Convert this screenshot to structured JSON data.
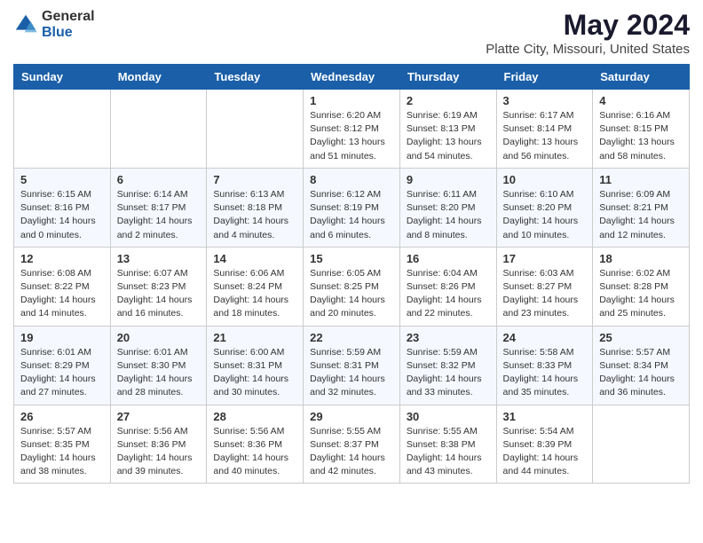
{
  "logo": {
    "general": "General",
    "blue": "Blue"
  },
  "title": "May 2024",
  "subtitle": "Platte City, Missouri, United States",
  "days_of_week": [
    "Sunday",
    "Monday",
    "Tuesday",
    "Wednesday",
    "Thursday",
    "Friday",
    "Saturday"
  ],
  "weeks": [
    [
      {
        "day": "",
        "info": ""
      },
      {
        "day": "",
        "info": ""
      },
      {
        "day": "",
        "info": ""
      },
      {
        "day": "1",
        "info": "Sunrise: 6:20 AM\nSunset: 8:12 PM\nDaylight: 13 hours\nand 51 minutes."
      },
      {
        "day": "2",
        "info": "Sunrise: 6:19 AM\nSunset: 8:13 PM\nDaylight: 13 hours\nand 54 minutes."
      },
      {
        "day": "3",
        "info": "Sunrise: 6:17 AM\nSunset: 8:14 PM\nDaylight: 13 hours\nand 56 minutes."
      },
      {
        "day": "4",
        "info": "Sunrise: 6:16 AM\nSunset: 8:15 PM\nDaylight: 13 hours\nand 58 minutes."
      }
    ],
    [
      {
        "day": "5",
        "info": "Sunrise: 6:15 AM\nSunset: 8:16 PM\nDaylight: 14 hours\nand 0 minutes."
      },
      {
        "day": "6",
        "info": "Sunrise: 6:14 AM\nSunset: 8:17 PM\nDaylight: 14 hours\nand 2 minutes."
      },
      {
        "day": "7",
        "info": "Sunrise: 6:13 AM\nSunset: 8:18 PM\nDaylight: 14 hours\nand 4 minutes."
      },
      {
        "day": "8",
        "info": "Sunrise: 6:12 AM\nSunset: 8:19 PM\nDaylight: 14 hours\nand 6 minutes."
      },
      {
        "day": "9",
        "info": "Sunrise: 6:11 AM\nSunset: 8:20 PM\nDaylight: 14 hours\nand 8 minutes."
      },
      {
        "day": "10",
        "info": "Sunrise: 6:10 AM\nSunset: 8:20 PM\nDaylight: 14 hours\nand 10 minutes."
      },
      {
        "day": "11",
        "info": "Sunrise: 6:09 AM\nSunset: 8:21 PM\nDaylight: 14 hours\nand 12 minutes."
      }
    ],
    [
      {
        "day": "12",
        "info": "Sunrise: 6:08 AM\nSunset: 8:22 PM\nDaylight: 14 hours\nand 14 minutes."
      },
      {
        "day": "13",
        "info": "Sunrise: 6:07 AM\nSunset: 8:23 PM\nDaylight: 14 hours\nand 16 minutes."
      },
      {
        "day": "14",
        "info": "Sunrise: 6:06 AM\nSunset: 8:24 PM\nDaylight: 14 hours\nand 18 minutes."
      },
      {
        "day": "15",
        "info": "Sunrise: 6:05 AM\nSunset: 8:25 PM\nDaylight: 14 hours\nand 20 minutes."
      },
      {
        "day": "16",
        "info": "Sunrise: 6:04 AM\nSunset: 8:26 PM\nDaylight: 14 hours\nand 22 minutes."
      },
      {
        "day": "17",
        "info": "Sunrise: 6:03 AM\nSunset: 8:27 PM\nDaylight: 14 hours\nand 23 minutes."
      },
      {
        "day": "18",
        "info": "Sunrise: 6:02 AM\nSunset: 8:28 PM\nDaylight: 14 hours\nand 25 minutes."
      }
    ],
    [
      {
        "day": "19",
        "info": "Sunrise: 6:01 AM\nSunset: 8:29 PM\nDaylight: 14 hours\nand 27 minutes."
      },
      {
        "day": "20",
        "info": "Sunrise: 6:01 AM\nSunset: 8:30 PM\nDaylight: 14 hours\nand 28 minutes."
      },
      {
        "day": "21",
        "info": "Sunrise: 6:00 AM\nSunset: 8:31 PM\nDaylight: 14 hours\nand 30 minutes."
      },
      {
        "day": "22",
        "info": "Sunrise: 5:59 AM\nSunset: 8:31 PM\nDaylight: 14 hours\nand 32 minutes."
      },
      {
        "day": "23",
        "info": "Sunrise: 5:59 AM\nSunset: 8:32 PM\nDaylight: 14 hours\nand 33 minutes."
      },
      {
        "day": "24",
        "info": "Sunrise: 5:58 AM\nSunset: 8:33 PM\nDaylight: 14 hours\nand 35 minutes."
      },
      {
        "day": "25",
        "info": "Sunrise: 5:57 AM\nSunset: 8:34 PM\nDaylight: 14 hours\nand 36 minutes."
      }
    ],
    [
      {
        "day": "26",
        "info": "Sunrise: 5:57 AM\nSunset: 8:35 PM\nDaylight: 14 hours\nand 38 minutes."
      },
      {
        "day": "27",
        "info": "Sunrise: 5:56 AM\nSunset: 8:36 PM\nDaylight: 14 hours\nand 39 minutes."
      },
      {
        "day": "28",
        "info": "Sunrise: 5:56 AM\nSunset: 8:36 PM\nDaylight: 14 hours\nand 40 minutes."
      },
      {
        "day": "29",
        "info": "Sunrise: 5:55 AM\nSunset: 8:37 PM\nDaylight: 14 hours\nand 42 minutes."
      },
      {
        "day": "30",
        "info": "Sunrise: 5:55 AM\nSunset: 8:38 PM\nDaylight: 14 hours\nand 43 minutes."
      },
      {
        "day": "31",
        "info": "Sunrise: 5:54 AM\nSunset: 8:39 PM\nDaylight: 14 hours\nand 44 minutes."
      },
      {
        "day": "",
        "info": ""
      }
    ]
  ]
}
